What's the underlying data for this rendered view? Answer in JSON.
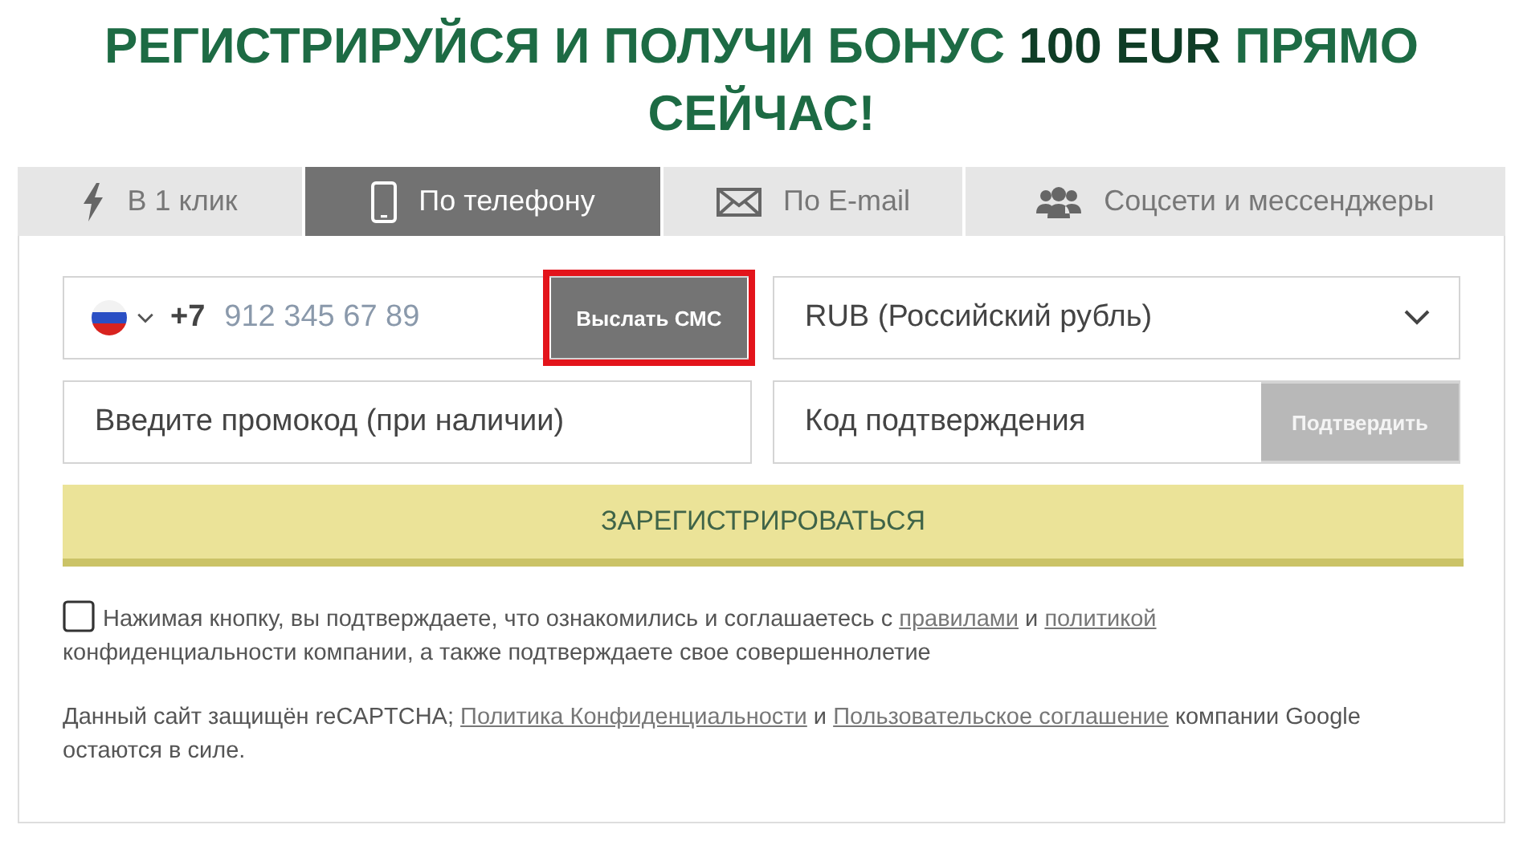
{
  "headline": "РЕГИСТРИРУЙСЯ И ПОЛУЧИ БОНУС **100 EUR** ПРЯМО СЕЙЧАС!",
  "tabs": [
    {
      "kind": "bolt",
      "label": "В 1 клик",
      "selected": false
    },
    {
      "kind": "phone",
      "label": "По телефону",
      "selected": true
    },
    {
      "kind": "mail",
      "label": "По E-mail",
      "selected": false
    },
    {
      "kind": "users",
      "label": "Соцсети и мессенджеры",
      "selected": false
    }
  ],
  "phone": {
    "code": "+7",
    "placeholder": "912 345 67 89",
    "send_button": {
      "label": "Выслать СМС",
      "highlighted": true
    }
  },
  "currency": {
    "value": "RUB (Российский рубль)"
  },
  "promo": {
    "placeholder": "Введите промокод (при наличии)"
  },
  "confirmation": {
    "placeholder": "Код подтверждения",
    "button": {
      "label": "Подтвердить",
      "disabled": true
    }
  },
  "register_button": "ЗАРЕГИСТРИРОВАТЬСЯ",
  "agreement": {
    "checked": false,
    "parts": [
      {
        "kind": "text",
        "text": "Нажимая кнопку, вы подтверждаете, что ознакомились и соглашаетесь с "
      },
      {
        "kind": "link",
        "text": "правилами"
      },
      {
        "kind": "text",
        "text": " и "
      },
      {
        "kind": "link",
        "text": "политикой"
      },
      {
        "kind": "text",
        "text": " конфиденциальности компании, а также подтверждаете свое совершеннолетие"
      }
    ]
  },
  "recaptcha": {
    "parts": [
      {
        "kind": "text",
        "text": "Данный сайт защищён reCAPTCHA; "
      },
      {
        "kind": "link",
        "text": "Политика Конфиденциальности"
      },
      {
        "kind": "text",
        "text": " и "
      },
      {
        "kind": "link",
        "text": "Пользовательское соглашение"
      },
      {
        "kind": "text",
        "text": " компании Google остаются в силе."
      }
    ]
  }
}
